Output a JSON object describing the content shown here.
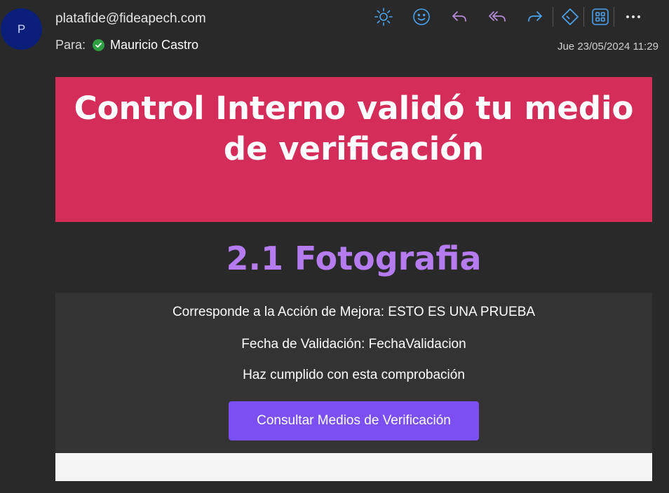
{
  "header": {
    "avatar_letter": "P",
    "sender": "platafide@fideapech.com",
    "to_label": "Para:",
    "recipient": "Mauricio Castro",
    "date": "Jue 23/05/2024 11:29"
  },
  "toolbar": {
    "icons": [
      "sun-icon",
      "emoji-icon",
      "reply-icon",
      "reply-all-icon",
      "forward-icon",
      "immersive-reader-icon",
      "apps-icon",
      "more-icon"
    ],
    "accent": "#4aa3f0",
    "reply_color": "#b58cd8"
  },
  "email": {
    "hero_title": "Control Interno validó tu medio de verificación",
    "hero_color": "#d42d5a",
    "subtitle": "2.1 Fotografia",
    "subtitle_color": "#b57cf0",
    "line1": "Corresponde a la Acción de Mejora: ESTO ES UNA PRUEBA",
    "line2": "Fecha de Validación: FechaValidacion",
    "line3": "Haz cumplido con esta comprobación",
    "cta_label": "Consultar Medios de Verificación",
    "cta_color": "#7b4ff2"
  }
}
